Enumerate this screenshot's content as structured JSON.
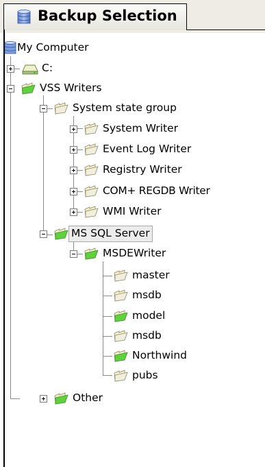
{
  "tab": {
    "label": "Backup Selection",
    "icon": "database-icon"
  },
  "tree": {
    "root": {
      "label": "My Computer",
      "icon": "computer-database-icon"
    },
    "items": [
      {
        "label": "C:",
        "icon": "drive-icon",
        "state": "collapsed"
      },
      {
        "label": "VSS Writers",
        "icon": "folder-green-icon",
        "state": "expanded"
      },
      {
        "label": "System state group",
        "icon": "folder-empty-icon",
        "state": "expanded"
      },
      {
        "label": "System Writer",
        "icon": "folder-empty-icon",
        "state": "collapsed"
      },
      {
        "label": "Event Log Writer",
        "icon": "folder-empty-icon",
        "state": "collapsed"
      },
      {
        "label": "Registry Writer",
        "icon": "folder-empty-icon",
        "state": "collapsed"
      },
      {
        "label": "COM+ REGDB Writer",
        "icon": "folder-empty-icon",
        "state": "collapsed"
      },
      {
        "label": "WMI Writer",
        "icon": "folder-empty-icon",
        "state": "collapsed"
      },
      {
        "label": "MS SQL Server",
        "icon": "folder-green-icon",
        "state": "expanded",
        "selected": true
      },
      {
        "label": "MSDEWriter",
        "icon": "folder-green-icon",
        "state": "expanded"
      },
      {
        "label": "master",
        "icon": "folder-empty-icon"
      },
      {
        "label": "msdb",
        "icon": "folder-empty-icon"
      },
      {
        "label": "model",
        "icon": "folder-green-icon"
      },
      {
        "label": "msdb",
        "icon": "folder-empty-icon"
      },
      {
        "label": "Northwind",
        "icon": "folder-green-icon"
      },
      {
        "label": "pubs",
        "icon": "folder-empty-icon"
      },
      {
        "label": "Other",
        "icon": "folder-green-icon",
        "state": "collapsed"
      }
    ]
  }
}
